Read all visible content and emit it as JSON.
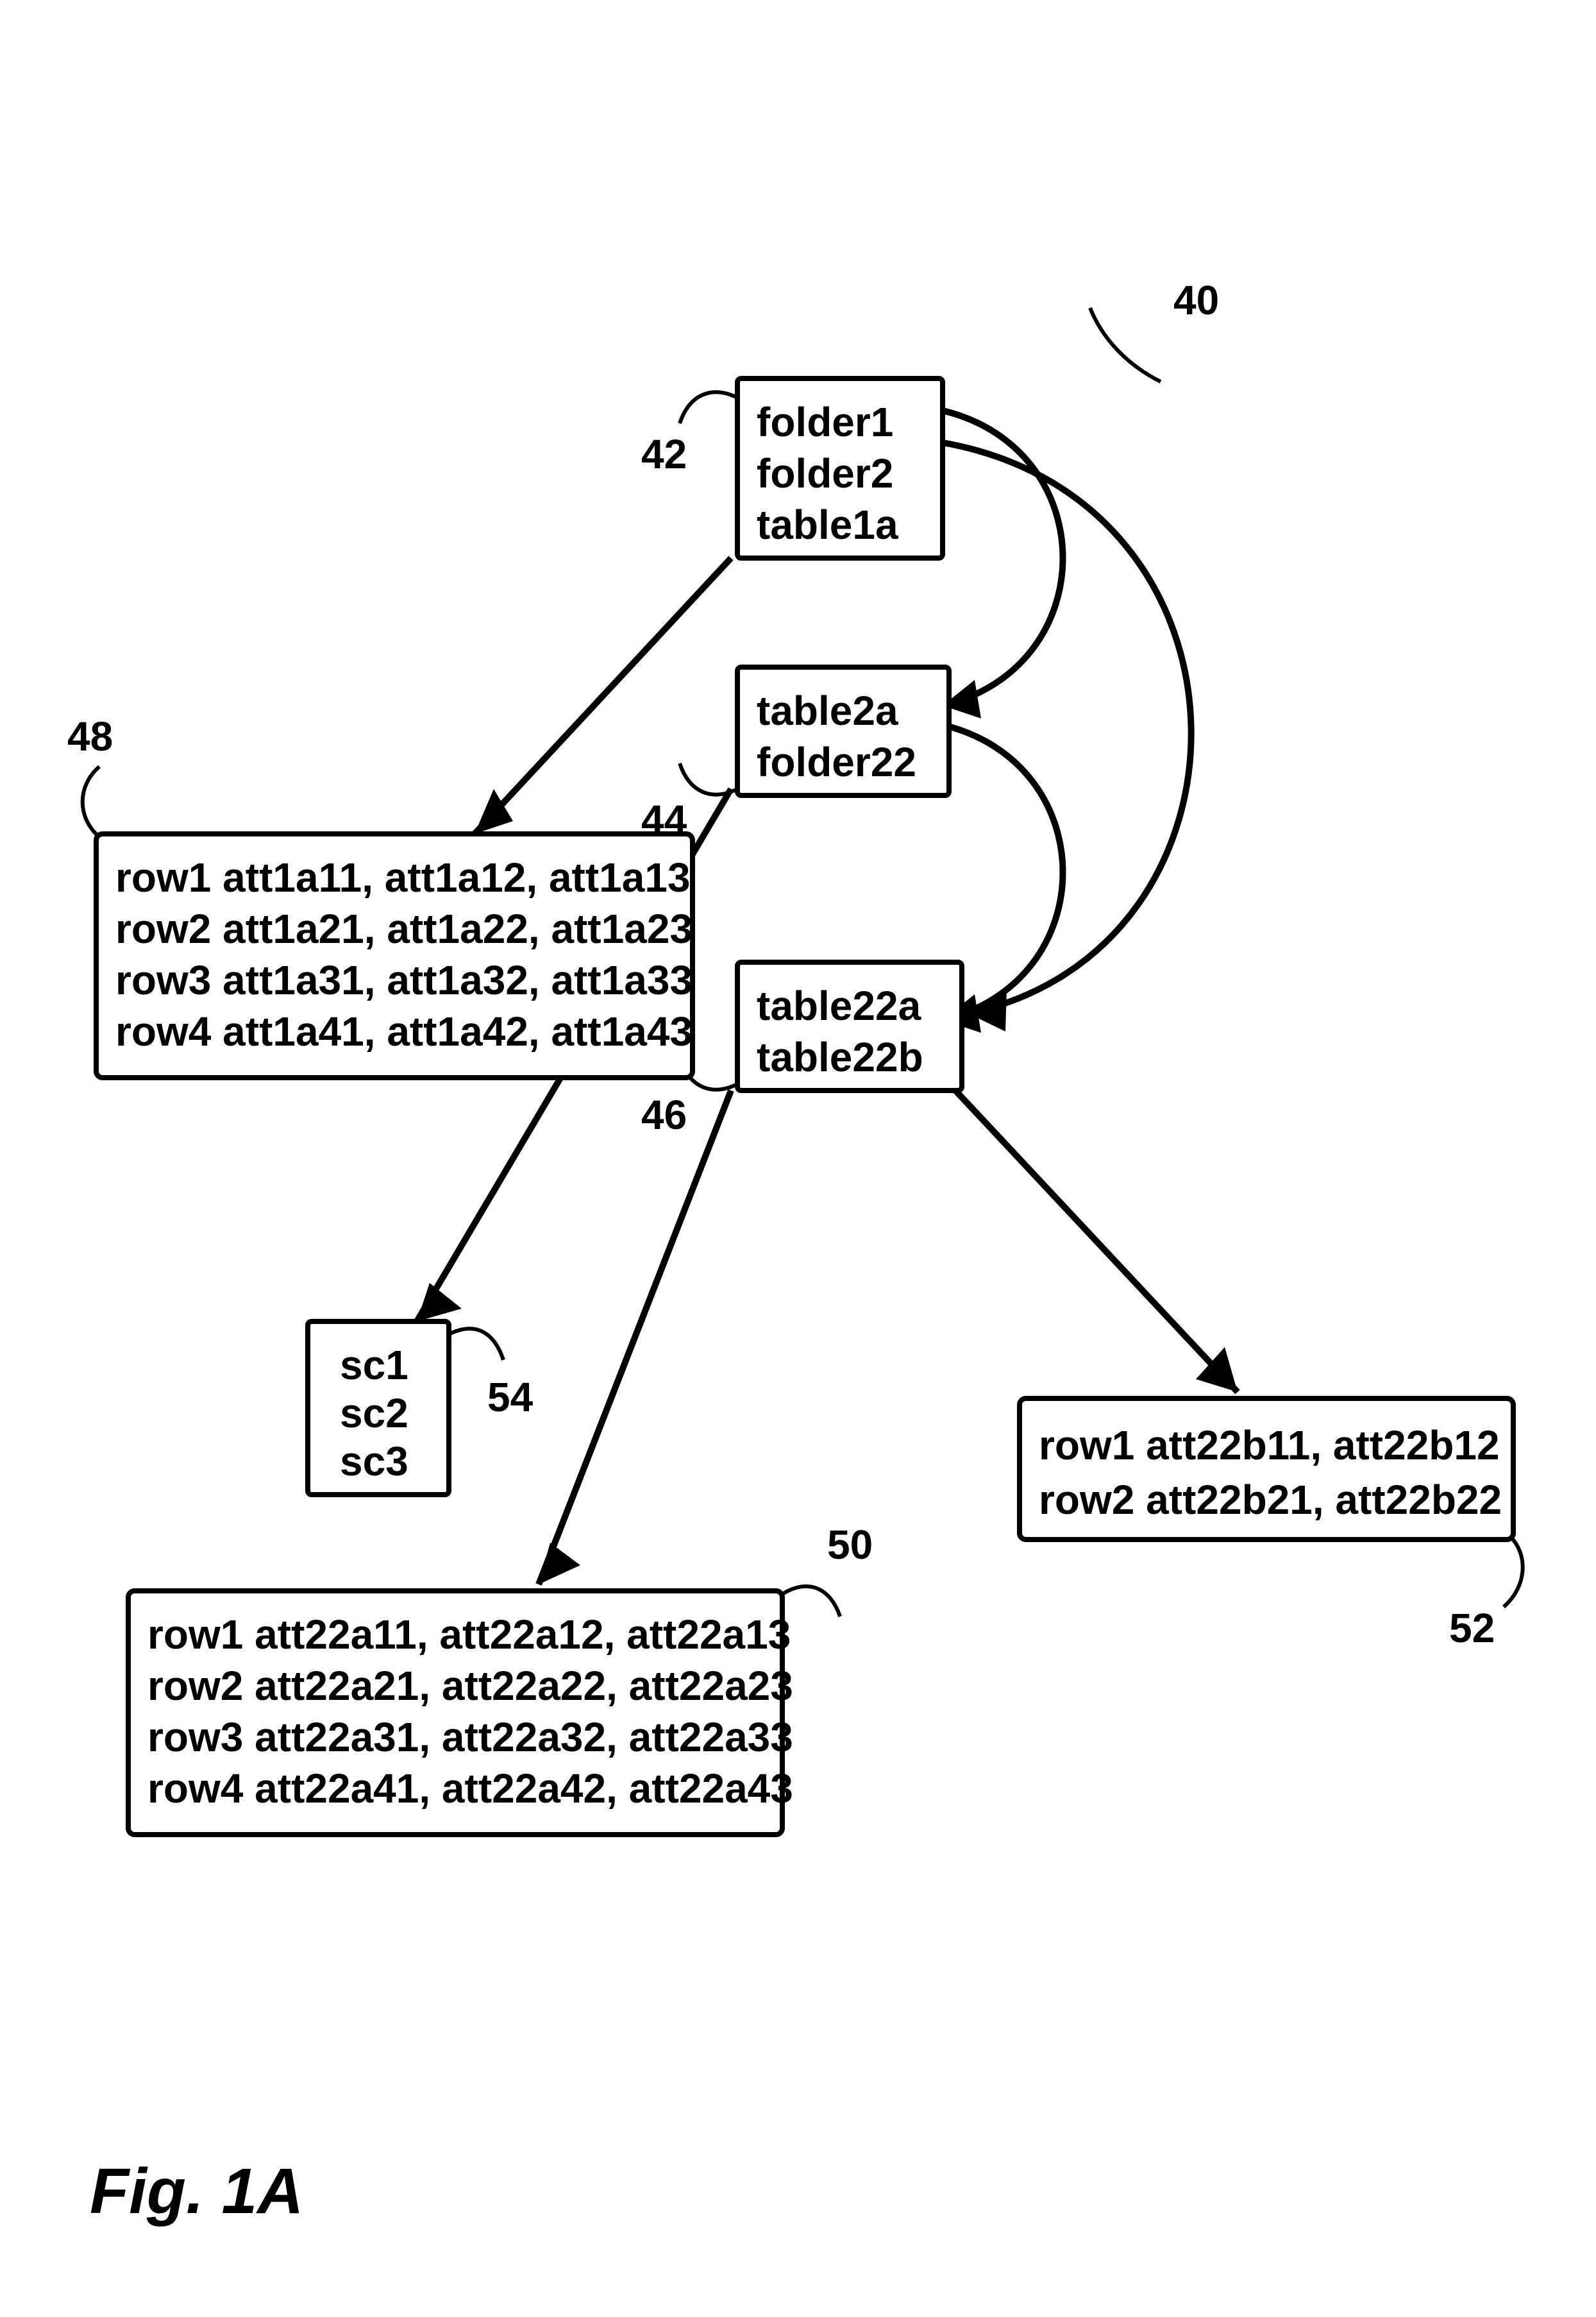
{
  "figure_label": "Fig. 1A",
  "diagram_ref": "40",
  "nodes": {
    "n42": {
      "ref": "42",
      "lines": [
        "folder1",
        "folder2",
        "table1a"
      ]
    },
    "n44": {
      "ref": "44",
      "lines": [
        "table2a",
        "folder22"
      ]
    },
    "n46": {
      "ref": "46",
      "lines": [
        "table22a",
        "table22b"
      ]
    },
    "n48": {
      "ref": "48",
      "lines": [
        "row1 att1a11, att1a12, att1a13",
        "row2 att1a21, att1a22, att1a23",
        "row3 att1a31, att1a32, att1a33",
        "row4 att1a41, att1a42, att1a43"
      ]
    },
    "n50": {
      "ref": "50",
      "lines": [
        "row1 att22a11, att22a12, att22a13",
        "row2 att22a21, att22a22, att22a23",
        "row3 att22a31, att22a32, att22a33",
        "row4 att22a41, att22a42, att22a43"
      ]
    },
    "n52": {
      "ref": "52",
      "lines": [
        "row1 att22b11, att22b12",
        "row2 att22b21, att22b22"
      ]
    },
    "n54": {
      "ref": "54",
      "lines": [
        "sc1",
        "sc2",
        "sc3"
      ]
    }
  }
}
